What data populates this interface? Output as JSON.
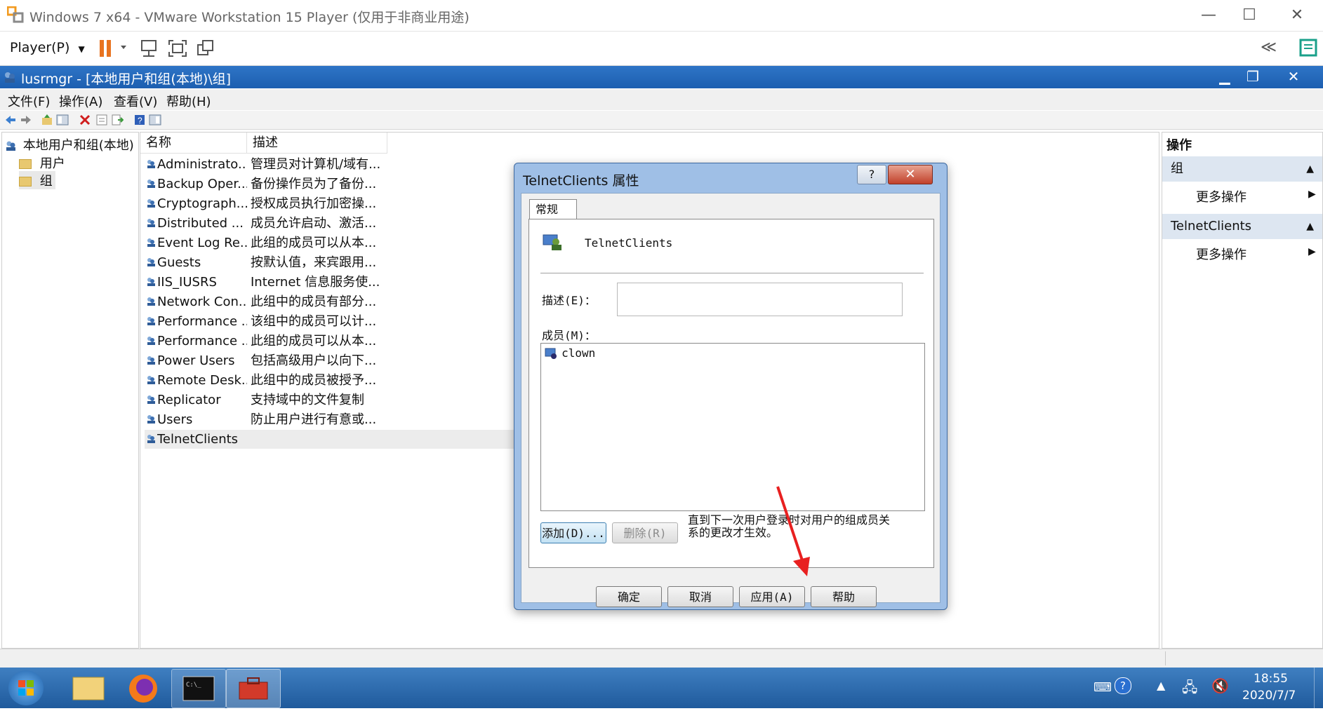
{
  "vmware": {
    "title": "Windows 7 x64 - VMware Workstation 15 Player (仅用于非商业用途)",
    "player_menu": "Player(P)",
    "collapse": "≪"
  },
  "mmc": {
    "title": "lusrmgr - [本地用户和组(本地)\\组]",
    "menu": [
      "文件(F)",
      "操作(A)",
      "查看(V)",
      "帮助(H)"
    ],
    "tree": {
      "root": "本地用户和组(本地)",
      "users": "用户",
      "groups": "组"
    },
    "columns": {
      "name": "名称",
      "desc": "描述"
    },
    "groups": [
      {
        "name": "Administrato...",
        "desc": "管理员对计算机/域有..."
      },
      {
        "name": "Backup Oper...",
        "desc": "备份操作员为了备份..."
      },
      {
        "name": "Cryptograph...",
        "desc": "授权成员执行加密操..."
      },
      {
        "name": "Distributed ...",
        "desc": "成员允许启动、激活..."
      },
      {
        "name": "Event Log Re...",
        "desc": "此组的成员可以从本..."
      },
      {
        "name": "Guests",
        "desc": "按默认值，来宾跟用..."
      },
      {
        "name": "IIS_IUSRS",
        "desc": "Internet 信息服务使..."
      },
      {
        "name": "Network Con...",
        "desc": "此组中的成员有部分..."
      },
      {
        "name": "Performance ...",
        "desc": "该组中的成员可以计..."
      },
      {
        "name": "Performance ...",
        "desc": "此组的成员可以从本..."
      },
      {
        "name": "Power Users",
        "desc": "包括高级用户以向下..."
      },
      {
        "name": "Remote Desk...",
        "desc": "此组中的成员被授予..."
      },
      {
        "name": "Replicator",
        "desc": "支持域中的文件复制"
      },
      {
        "name": "Users",
        "desc": "防止用户进行有意或..."
      },
      {
        "name": "TelnetClients",
        "desc": ""
      }
    ],
    "actions": {
      "title": "操作",
      "section1": "组",
      "more1": "更多操作",
      "section2": "TelnetClients",
      "more2": "更多操作"
    }
  },
  "dialog": {
    "title": "TelnetClients 属性",
    "help_btn": "?",
    "close_btn": "✕",
    "tab": "常规",
    "group_name": "TelnetClients",
    "desc_label": "描述(E)：",
    "desc_value": "",
    "members_label": "成员(M)：",
    "members": [
      "clown"
    ],
    "add": "添加(D)...",
    "remove": "删除(R)",
    "note": "直到下一次用户登录时对用户的组成员关系的更改才生效。",
    "ok": "确定",
    "cancel": "取消",
    "apply": "应用(A)",
    "help": "帮助"
  },
  "taskbar": {
    "time": "18:55",
    "date": "2020/7/7"
  }
}
